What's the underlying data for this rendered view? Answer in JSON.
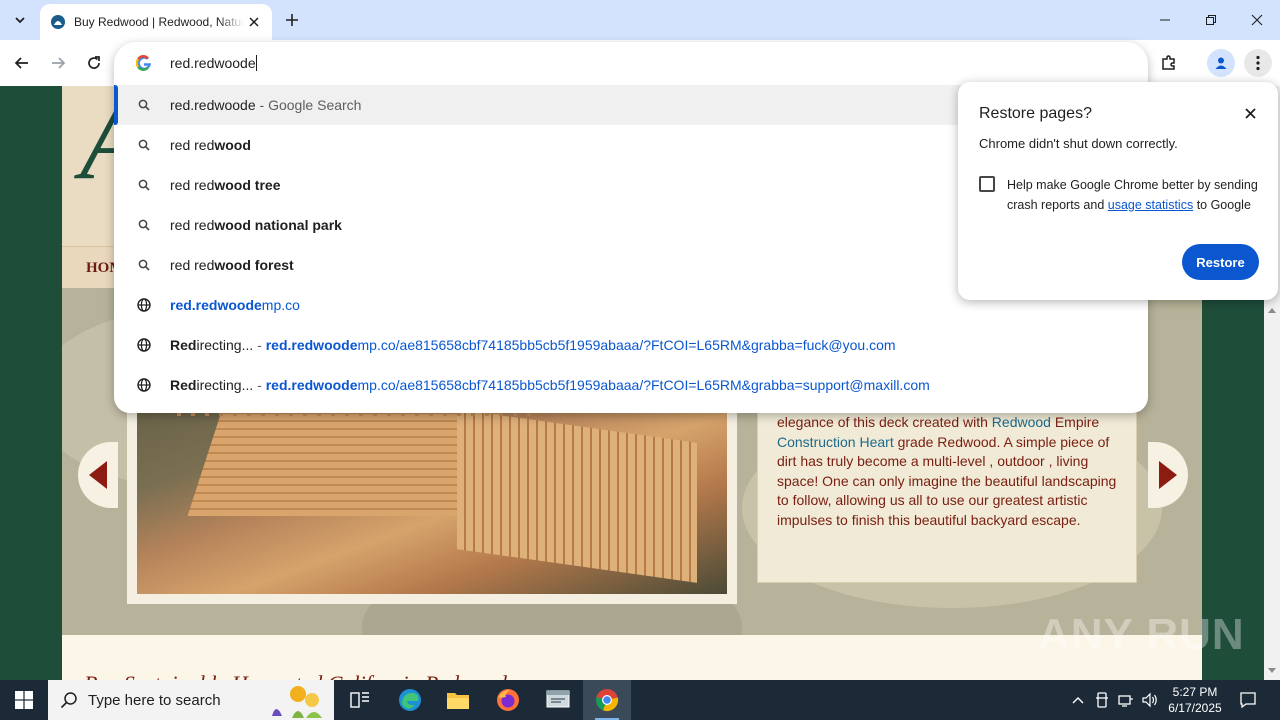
{
  "browser": {
    "tab_title": "Buy Redwood | Redwood, Natural",
    "colors": {
      "tabstrip": "#d3e3fd",
      "accent": "#0b57d0"
    }
  },
  "omnibox": {
    "text": "red.redwoode",
    "suggestions": [
      {
        "icon": "search-icon",
        "typed": "red.redwoode",
        "rest": "",
        "suffix": " - Google Search",
        "kind": "search"
      },
      {
        "icon": "search-icon",
        "typed": "red red",
        "rest": "wood",
        "suffix": "",
        "kind": "search"
      },
      {
        "icon": "search-icon",
        "typed": "red red",
        "rest": "wood tree",
        "suffix": "",
        "kind": "search"
      },
      {
        "icon": "search-icon",
        "typed": "red red",
        "rest": "wood national park",
        "suffix": "",
        "kind": "search"
      },
      {
        "icon": "search-icon",
        "typed": "red red",
        "rest": "wood forest",
        "suffix": "",
        "kind": "search"
      },
      {
        "icon": "globe-icon",
        "url_bold": "red.redwoode",
        "url_rest": "mp.co",
        "kind": "url"
      },
      {
        "icon": "globe-icon",
        "title_bold": "Red",
        "title_rest": "irecting...",
        "sep": " - ",
        "url_bold": "red.redwoode",
        "url_rest": "mp.co/ae815658cbf74185bb5cb5f1959abaaa/?FtCOI=L65RM&grabba=fuck@you.com",
        "kind": "titled-url"
      },
      {
        "icon": "globe-icon",
        "title_bold": "Red",
        "title_rest": "irecting...",
        "sep": " - ",
        "url_bold": "red.redwoode",
        "url_rest": "mp.co/ae815658cbf74185bb5cb5f1959abaaa/?FtCOI=L65RM&grabba=support@maxill.com",
        "kind": "titled-url"
      }
    ]
  },
  "restore_popup": {
    "title": "Restore pages?",
    "message": "Chrome didn't shut down correctly.",
    "help_text_1": "Help make Google Chrome better by sending crash reports and ",
    "help_link": "usage statistics",
    "help_text_2": " to Google",
    "button": "Restore",
    "checked": false
  },
  "page": {
    "logo_letter": "A",
    "nav_home": "HOM",
    "description": {
      "line_prefix": "elegance of this deck created with ",
      "link1": "Redwood",
      "mid1": " Empire ",
      "link2": "Construction Heart",
      "rest": " grade Redwood. A simple piece of dirt has truly become a multi-level , outdoor , living space! One can only imagine the beautiful landscaping to follow, allowing us all to use our greatest artistic impulses to finish this beautiful backyard escape."
    },
    "bottom_title": "Buy Sustainably Harvested California Redwood",
    "colors": {
      "text": "#7a2012",
      "link": "#1c6b8a",
      "bg": "#1e4d3a"
    }
  },
  "watermark": "ANY RUN",
  "taskbar": {
    "search_placeholder": "Type here to search",
    "time": "5:27 PM",
    "date": "6/17/2025"
  }
}
